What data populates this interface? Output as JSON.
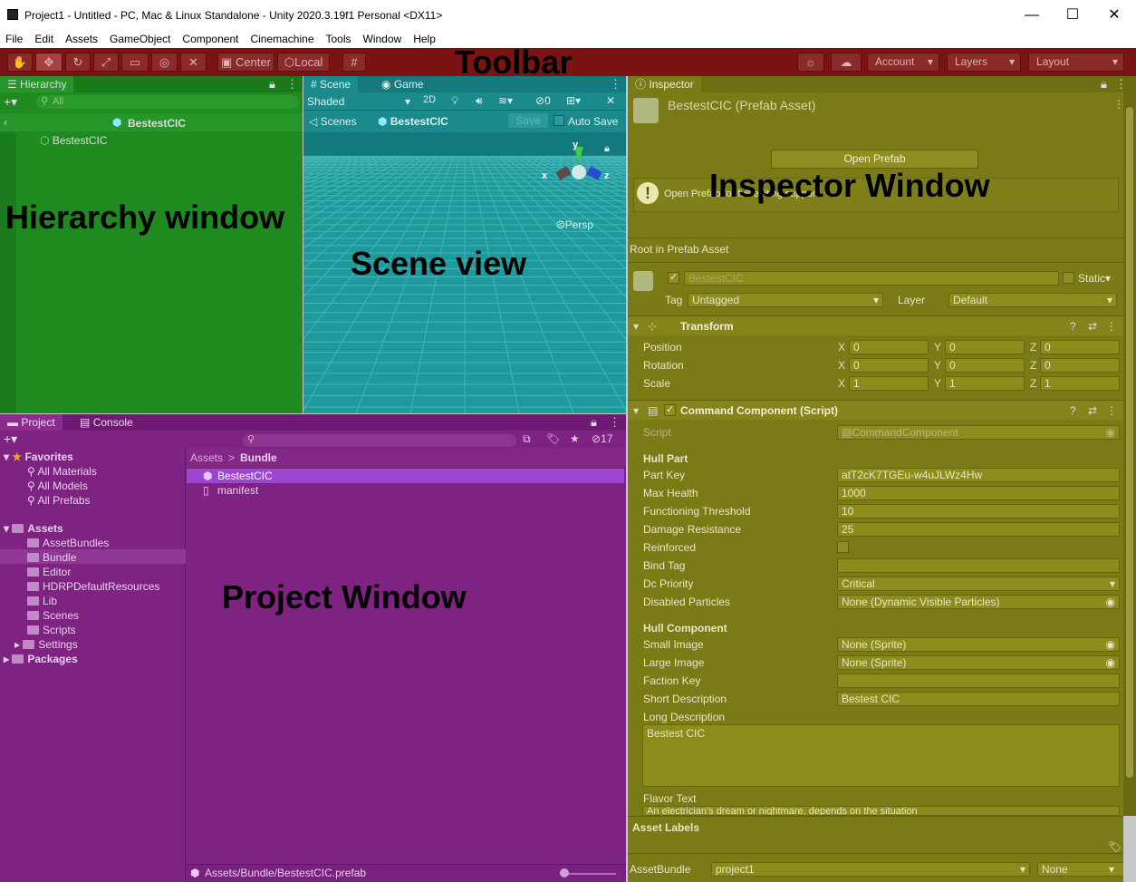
{
  "window": {
    "title": "Project1 - Untitled - PC, Mac & Linux Standalone - Unity 2020.3.19f1 Personal <DX11>",
    "minimize": "—",
    "maximize": "☐",
    "close": "✕"
  },
  "menu": [
    "File",
    "Edit",
    "Assets",
    "GameObject",
    "Component",
    "Cinemachine",
    "Tools",
    "Window",
    "Help"
  ],
  "toolbar": {
    "center": "Center",
    "local": "Local",
    "account": "Account",
    "layers": "Layers",
    "layout": "Layout",
    "overlay_label": "Toolbar"
  },
  "hierarchy": {
    "tab": "Hierarchy",
    "search_placeholder": "All",
    "scene_root": "BestestCIC",
    "item": "BestestCIC",
    "overlay_label": "Hierarchy window"
  },
  "scene": {
    "tab_scene": "Scene",
    "tab_game": "Game",
    "shading": "Shaded",
    "mode_2d": "2D",
    "hidden_count": "0",
    "breadcrumb_scenes": "Scenes",
    "breadcrumb_prefab": "BestestCIC",
    "save": "Save",
    "auto_save": "Auto Save",
    "gizmo_y": "y",
    "gizmo_x": "x",
    "gizmo_z": "z",
    "persp": "Persp",
    "overlay_label": "Scene view"
  },
  "inspector": {
    "tab": "Inspector",
    "object_title": "BestestCIC (Prefab Asset)",
    "open_prefab": "Open Prefab",
    "hint": "Open Prefab for full editing support.",
    "overlay_label": "Inspector Window",
    "root_label": "Root in Prefab Asset",
    "object_name": "BestestCIC",
    "static": "Static",
    "tag_label": "Tag",
    "tag_value": "Untagged",
    "layer_label": "Layer",
    "layer_value": "Default",
    "transform": {
      "title": "Transform",
      "rows": [
        {
          "label": "Position",
          "x": "0",
          "y": "0",
          "z": "0"
        },
        {
          "label": "Rotation",
          "x": "0",
          "y": "0",
          "z": "0"
        },
        {
          "label": "Scale",
          "x": "1",
          "y": "1",
          "z": "1"
        }
      ]
    },
    "component": {
      "title": "Command Component (Script)",
      "script_label": "Script",
      "script_value": "CommandComponent",
      "hull_part_header": "Hull Part",
      "fields": [
        {
          "label": "Part Key",
          "value": "atT2cK7TGEu-w4uJLWz4Hw"
        },
        {
          "label": "Max Health",
          "value": "1000"
        },
        {
          "label": "Functioning Threshold",
          "value": "10"
        },
        {
          "label": "Damage Resistance",
          "value": "25"
        },
        {
          "label": "Reinforced",
          "value": ""
        },
        {
          "label": "Bind Tag",
          "value": ""
        },
        {
          "label": "Dc Priority",
          "value": "Critical"
        },
        {
          "label": "Disabled Particles",
          "value": "None (Dynamic Visible Particles)"
        }
      ],
      "hull_component_header": "Hull Component",
      "fields2": [
        {
          "label": "Small Image",
          "value": "None (Sprite)"
        },
        {
          "label": "Large Image",
          "value": "None (Sprite)"
        },
        {
          "label": "Faction Key",
          "value": ""
        },
        {
          "label": "Short Description",
          "value": "Bestest CIC"
        }
      ],
      "long_desc_label": "Long Description",
      "long_desc_value": "Bestest CIC",
      "flavor_label": "Flavor Text",
      "flavor_value": "An electrician's dream or nightmare, depends on the situation"
    },
    "asset_labels": "Asset Labels",
    "assetbundle_label": "AssetBundle",
    "assetbundle_value": "project1",
    "assetbundle_variant": "None"
  },
  "project": {
    "tab_project": "Project",
    "tab_console": "Console",
    "hidden_count": "17",
    "overlay_label": "Project Window",
    "favorites": "Favorites",
    "fav_items": [
      "All Materials",
      "All Models",
      "All Prefabs"
    ],
    "assets": "Assets",
    "asset_folders": [
      "AssetBundles",
      "Bundle",
      "Editor",
      "HDRPDefaultResources",
      "Lib",
      "Scenes",
      "Scripts",
      "Settings"
    ],
    "packages": "Packages",
    "breadcrumb_root": "Assets",
    "breadcrumb_sep": ">",
    "breadcrumb_current": "Bundle",
    "files": [
      "BestestCIC",
      "manifest"
    ],
    "status_path": "Assets/Bundle/BestestCIC.prefab"
  }
}
